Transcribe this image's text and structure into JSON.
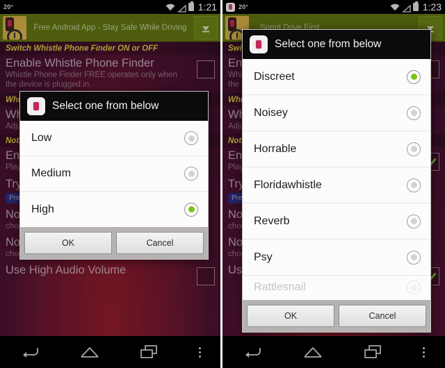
{
  "left": {
    "statusbar": {
      "temperature": "20°",
      "time": "1:21",
      "wifi_icon": "wifi-icon",
      "signal_icon": "signal-icon",
      "battery_icon": "battery-icon"
    },
    "ad": {
      "text": "Free Android App - Stay Safe While Driving",
      "download_icon": "download-arrow-icon",
      "app_icon": "driving-app-icon"
    },
    "background_rows": [
      {
        "kind": "section",
        "text": "Switch Whistle Phone Finder ON or OFF"
      },
      {
        "kind": "row",
        "title": "Enable Whistle Phone Finder",
        "sub": "Whistle Phone Finder FREE operates only when the device is plugged in.",
        "checkbox": "unchecked"
      },
      {
        "kind": "section",
        "text": "Whistle Detector Sensitivity Adjustment"
      },
      {
        "kind": "row",
        "title": "Whistle Sensitivity",
        "sub": "Adjust the detector sensitivity",
        "checkbox": "none"
      },
      {
        "kind": "section",
        "text": "Notification Settings"
      },
      {
        "kind": "row",
        "title": "Enable Notification Sound",
        "sub": "Plays a sound when whistle is detected",
        "checkbox": "none"
      },
      {
        "kind": "row",
        "title": "Try Sound",
        "sub": "",
        "checkbox": "none",
        "pill": "Preview"
      },
      {
        "kind": "row",
        "title": "Notification Sound of App",
        "sub": "choose preinstall Sounds",
        "checkbox": "none"
      },
      {
        "kind": "row",
        "title": "Notification Sound of Phone",
        "sub": "choose phone's Sounds",
        "checkbox": "none"
      },
      {
        "kind": "row",
        "title": "Use High Audio Volume",
        "sub": "",
        "checkbox": "unchecked"
      }
    ],
    "dialog": {
      "title": "Select one from below",
      "app_icon": "whistle-app-icon",
      "items": [
        {
          "label": "Low",
          "selected": false
        },
        {
          "label": "Medium",
          "selected": false
        },
        {
          "label": "High",
          "selected": true
        }
      ],
      "ok_label": "OK",
      "cancel_label": "Cancel"
    },
    "navbar": {
      "back_icon": "back-arrow-icon",
      "home_icon": "home-icon",
      "recents_icon": "recent-apps-icon",
      "overflow_icon": "overflow-menu-icon"
    }
  },
  "right": {
    "statusbar": {
      "app_icon": "whistle-app-icon",
      "temperature": "20°",
      "time": "1:23",
      "wifi_icon": "wifi-icon",
      "signal_icon": "signal-icon",
      "battery_icon": "battery-icon"
    },
    "ad": {
      "text": "Sprint Drive First",
      "download_icon": "download-arrow-icon",
      "app_icon": "driving-app-icon"
    },
    "background_rows": [
      {
        "kind": "section",
        "text": "Switch Whistle Phone Finder ON or OFF"
      },
      {
        "kind": "row",
        "title": "Enable Whistle Phone Finder",
        "sub": "Whistle Phone Finder FREE operates only when the device is plugged in.",
        "checkbox": "unchecked"
      },
      {
        "kind": "section",
        "text": "Whistle Detector Sensitivity Adjustment"
      },
      {
        "kind": "row",
        "title": "Whistle Sensitivity",
        "sub": "Adjust the detector sensitivity",
        "checkbox": "none"
      },
      {
        "kind": "section",
        "text": "Notification Settings"
      },
      {
        "kind": "row",
        "title": "Enable Notification Sound",
        "sub": "Plays a sound when whistle is detected",
        "checkbox": "checked"
      },
      {
        "kind": "row",
        "title": "Try Sound",
        "sub": "",
        "checkbox": "none",
        "pill": "Preview"
      },
      {
        "kind": "row",
        "title": "Notification Sound of App",
        "sub": "choose preinstall Sounds",
        "checkbox": "none"
      },
      {
        "kind": "row",
        "title": "Notification Sound of Phone",
        "sub": "choose phone's Sounds",
        "checkbox": "none"
      },
      {
        "kind": "row",
        "title": "Use High Audio Volume",
        "sub": "",
        "checkbox": "checked"
      }
    ],
    "dialog": {
      "title": "Select one from below",
      "app_icon": "whistle-app-icon",
      "items": [
        {
          "label": "Discreet",
          "selected": true
        },
        {
          "label": "Noisey",
          "selected": false
        },
        {
          "label": "Horrable",
          "selected": false
        },
        {
          "label": "Floridawhistle",
          "selected": false
        },
        {
          "label": "Reverb",
          "selected": false
        },
        {
          "label": "Psy",
          "selected": false
        }
      ],
      "partial_item_label": "Rattlesnail",
      "ok_label": "OK",
      "cancel_label": "Cancel"
    },
    "navbar": {
      "back_icon": "back-arrow-icon",
      "home_icon": "home-icon",
      "recents_icon": "recent-apps-icon",
      "overflow_icon": "overflow-menu-icon"
    }
  },
  "colors": {
    "accent_green": "#7bc419",
    "ad_banner": "#5e7211",
    "section_header": "#d7c246",
    "dialog_frame": "#b7b3b3"
  }
}
